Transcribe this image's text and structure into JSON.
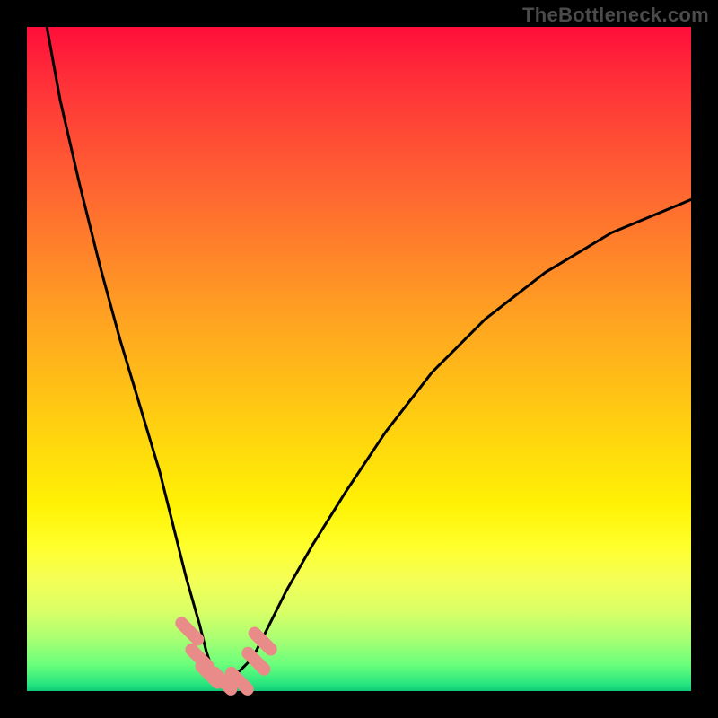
{
  "watermark": "TheBottleneck.com",
  "chart_data": {
    "type": "line",
    "title": "",
    "xlabel": "",
    "ylabel": "",
    "xlim": [
      0,
      100
    ],
    "ylim": [
      0,
      100
    ],
    "series": [
      {
        "name": "bottleneck-curve",
        "x": [
          3,
          5,
          8,
          11,
          14,
          17,
          20,
          22,
          24,
          26,
          27,
          28,
          29,
          30,
          32,
          34,
          36,
          39,
          43,
          48,
          54,
          61,
          69,
          78,
          88,
          100
        ],
        "values": [
          100,
          89,
          76,
          64,
          53,
          43,
          33,
          25,
          17,
          10,
          6,
          3,
          2,
          2,
          3,
          5,
          9,
          15,
          22,
          30,
          39,
          48,
          56,
          63,
          69,
          74
        ]
      }
    ],
    "markers": [
      {
        "name": "marker-a",
        "x": 24.5,
        "y": 9.0
      },
      {
        "name": "marker-b",
        "x": 26.0,
        "y": 5.0
      },
      {
        "name": "marker-c",
        "x": 27.5,
        "y": 2.5
      },
      {
        "name": "marker-d",
        "x": 29.5,
        "y": 1.5
      },
      {
        "name": "marker-e",
        "x": 32.0,
        "y": 1.5
      },
      {
        "name": "marker-f",
        "x": 34.5,
        "y": 4.5
      },
      {
        "name": "marker-g",
        "x": 35.5,
        "y": 7.5
      }
    ],
    "gradient_stops": [
      {
        "pos": 0,
        "color": "#ff0e3a"
      },
      {
        "pos": 36,
        "color": "#ff8a28"
      },
      {
        "pos": 72,
        "color": "#fff205"
      },
      {
        "pos": 100,
        "color": "#0fc97a"
      }
    ]
  }
}
